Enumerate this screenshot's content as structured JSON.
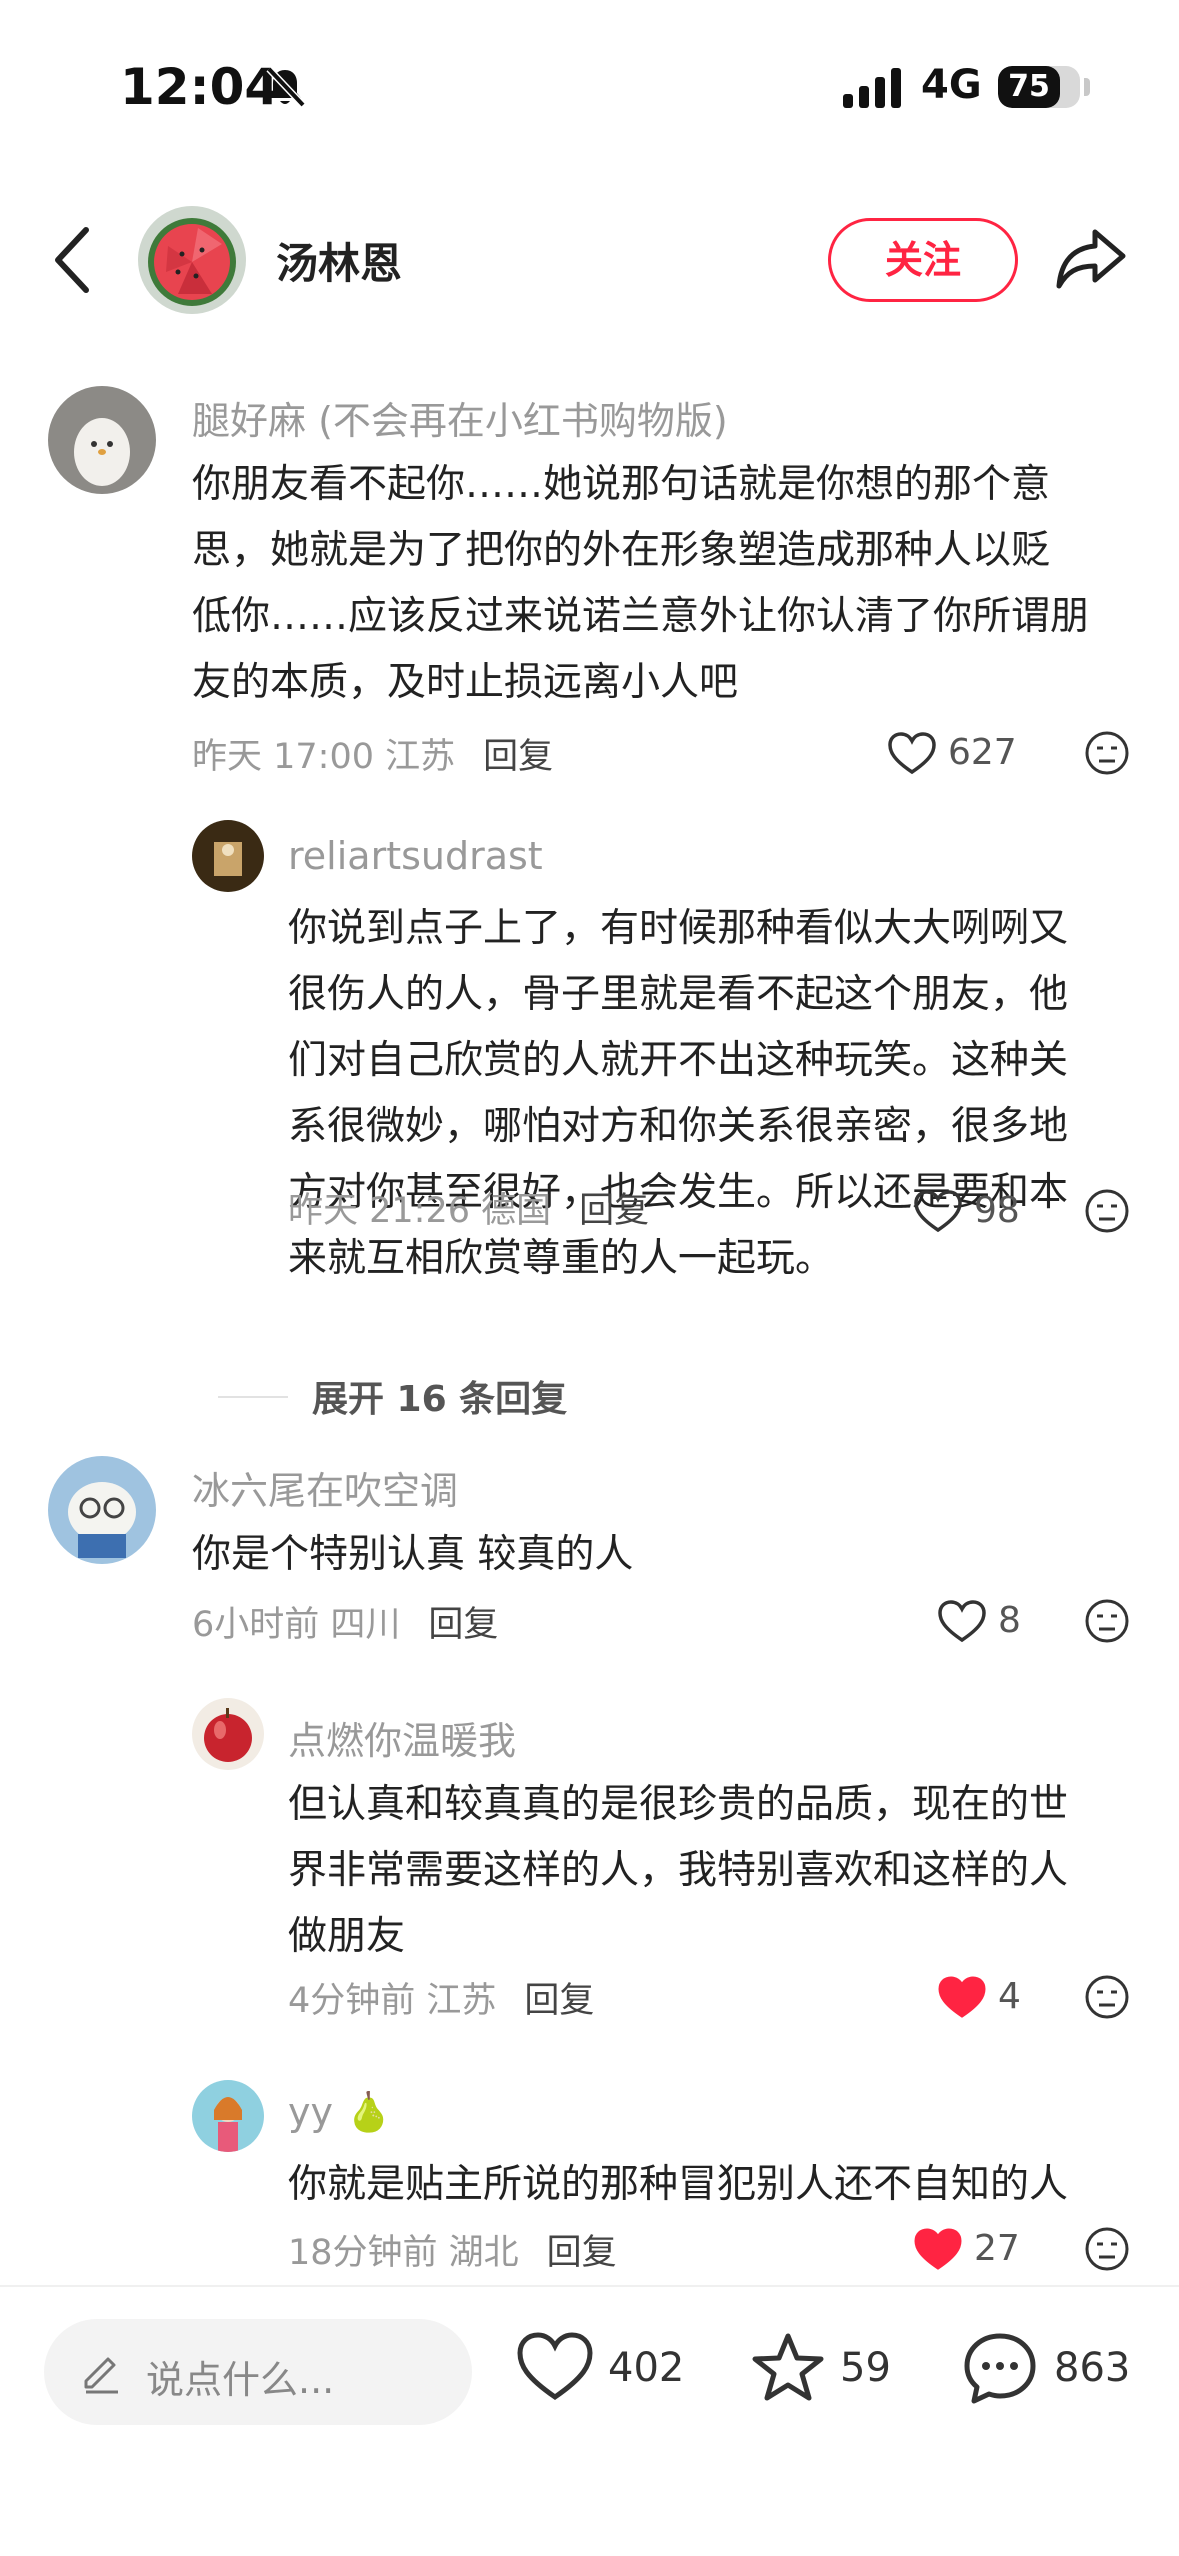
{
  "status_bar": {
    "time": "12:04",
    "network": "4G",
    "battery": "75",
    "battery_level": 0.75
  },
  "nav": {
    "author_name": "汤林恩",
    "follow_label": "关注"
  },
  "comments": [
    {
      "name": "腿好麻 (不会再在小红书购物版)",
      "lines": [
        "你朋友看不起你……她说那句话就是你想的那个意",
        "思，她就是为了把你的外在形象塑造成那种人以贬",
        "低你……应该反过来说诺兰意外让你认清了你所谓朋",
        "友的本质，及时止损远离小人吧"
      ],
      "meta": "昨天 17:00 江苏",
      "reply": "回复",
      "likes": "627",
      "liked": false
    },
    {
      "name": "reliartsudrast",
      "lines": [
        "你说到点子上了，有时候那种看似大大咧咧又",
        "很伤人的人，骨子里就是看不起这个朋友，他",
        "们对自己欣赏的人就开不出这种玩笑。这种关",
        "系很微妙，哪怕对方和你关系很亲密，很多地",
        "方对你甚至很好，也会发生。所以还是要和本",
        "来就互相欣赏尊重的人一起玩。"
      ],
      "meta": "昨天 21:26 德国",
      "reply": "回复",
      "likes": "98",
      "liked": false
    },
    {
      "name": "冰六尾在吹空调",
      "lines": [
        "你是个特别认真 较真的人"
      ],
      "meta": "6小时前 四川",
      "reply": "回复",
      "likes": "8",
      "liked": false
    },
    {
      "name": "点燃你温暖我",
      "lines": [
        "但认真和较真真的是很珍贵的品质，现在的世",
        "界非常需要这样的人，我特别喜欢和这样的人",
        "做朋友"
      ],
      "meta": "4分钟前 江苏",
      "reply": "回复",
      "likes": "4",
      "liked": true
    },
    {
      "name": "yy",
      "name_emoji": "🍐",
      "lines": [
        "你就是贴主所说的那种冒犯别人还不自知的人"
      ],
      "meta": "18分钟前 湖北",
      "reply": "回复",
      "likes": "27",
      "liked": true
    }
  ],
  "expand_replies": "展开 16 条回复",
  "bottom_bar": {
    "placeholder": "说点什么...",
    "likes": "402",
    "stars": "59",
    "comments": "863"
  },
  "colors": {
    "accent": "#ff2442",
    "muted": "#999999",
    "text": "#222222"
  }
}
